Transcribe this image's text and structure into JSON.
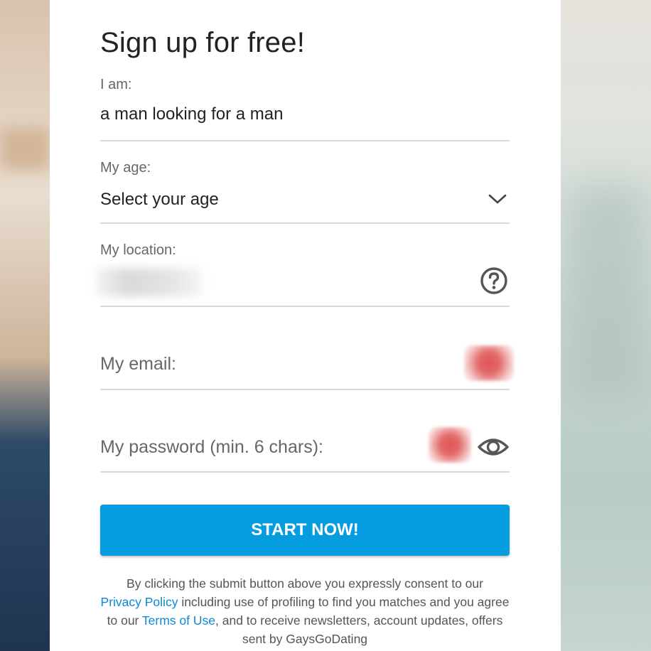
{
  "form": {
    "title": "Sign up for free!",
    "iam": {
      "label": "I am:",
      "value": "a man looking for a man"
    },
    "age": {
      "label": "My age:",
      "value": "Select your age"
    },
    "location": {
      "label": "My location:"
    },
    "email": {
      "label": "My email:"
    },
    "password": {
      "label": "My password (min. 6 chars):"
    },
    "submit_label": "START NOW!",
    "consent": {
      "text_1": "By clicking the submit button above you expressly consent to our",
      "privacy_link": "Privacy Policy",
      "text_2": " including use of profiling to find you matches and you agree to our ",
      "terms_link": "Terms of Use",
      "text_3": ", and to receive newsletters, account updates, offers sent by GaysGoDating"
    }
  },
  "icons": {
    "age_dropdown": "chevron-down-icon",
    "location_help": "question-circle-icon",
    "password_toggle": "eye-icon"
  },
  "colors": {
    "accent": "#069de0",
    "link": "#0a8ad4",
    "text": "#222222",
    "muted": "#666666",
    "divider": "#d8d8d8"
  }
}
